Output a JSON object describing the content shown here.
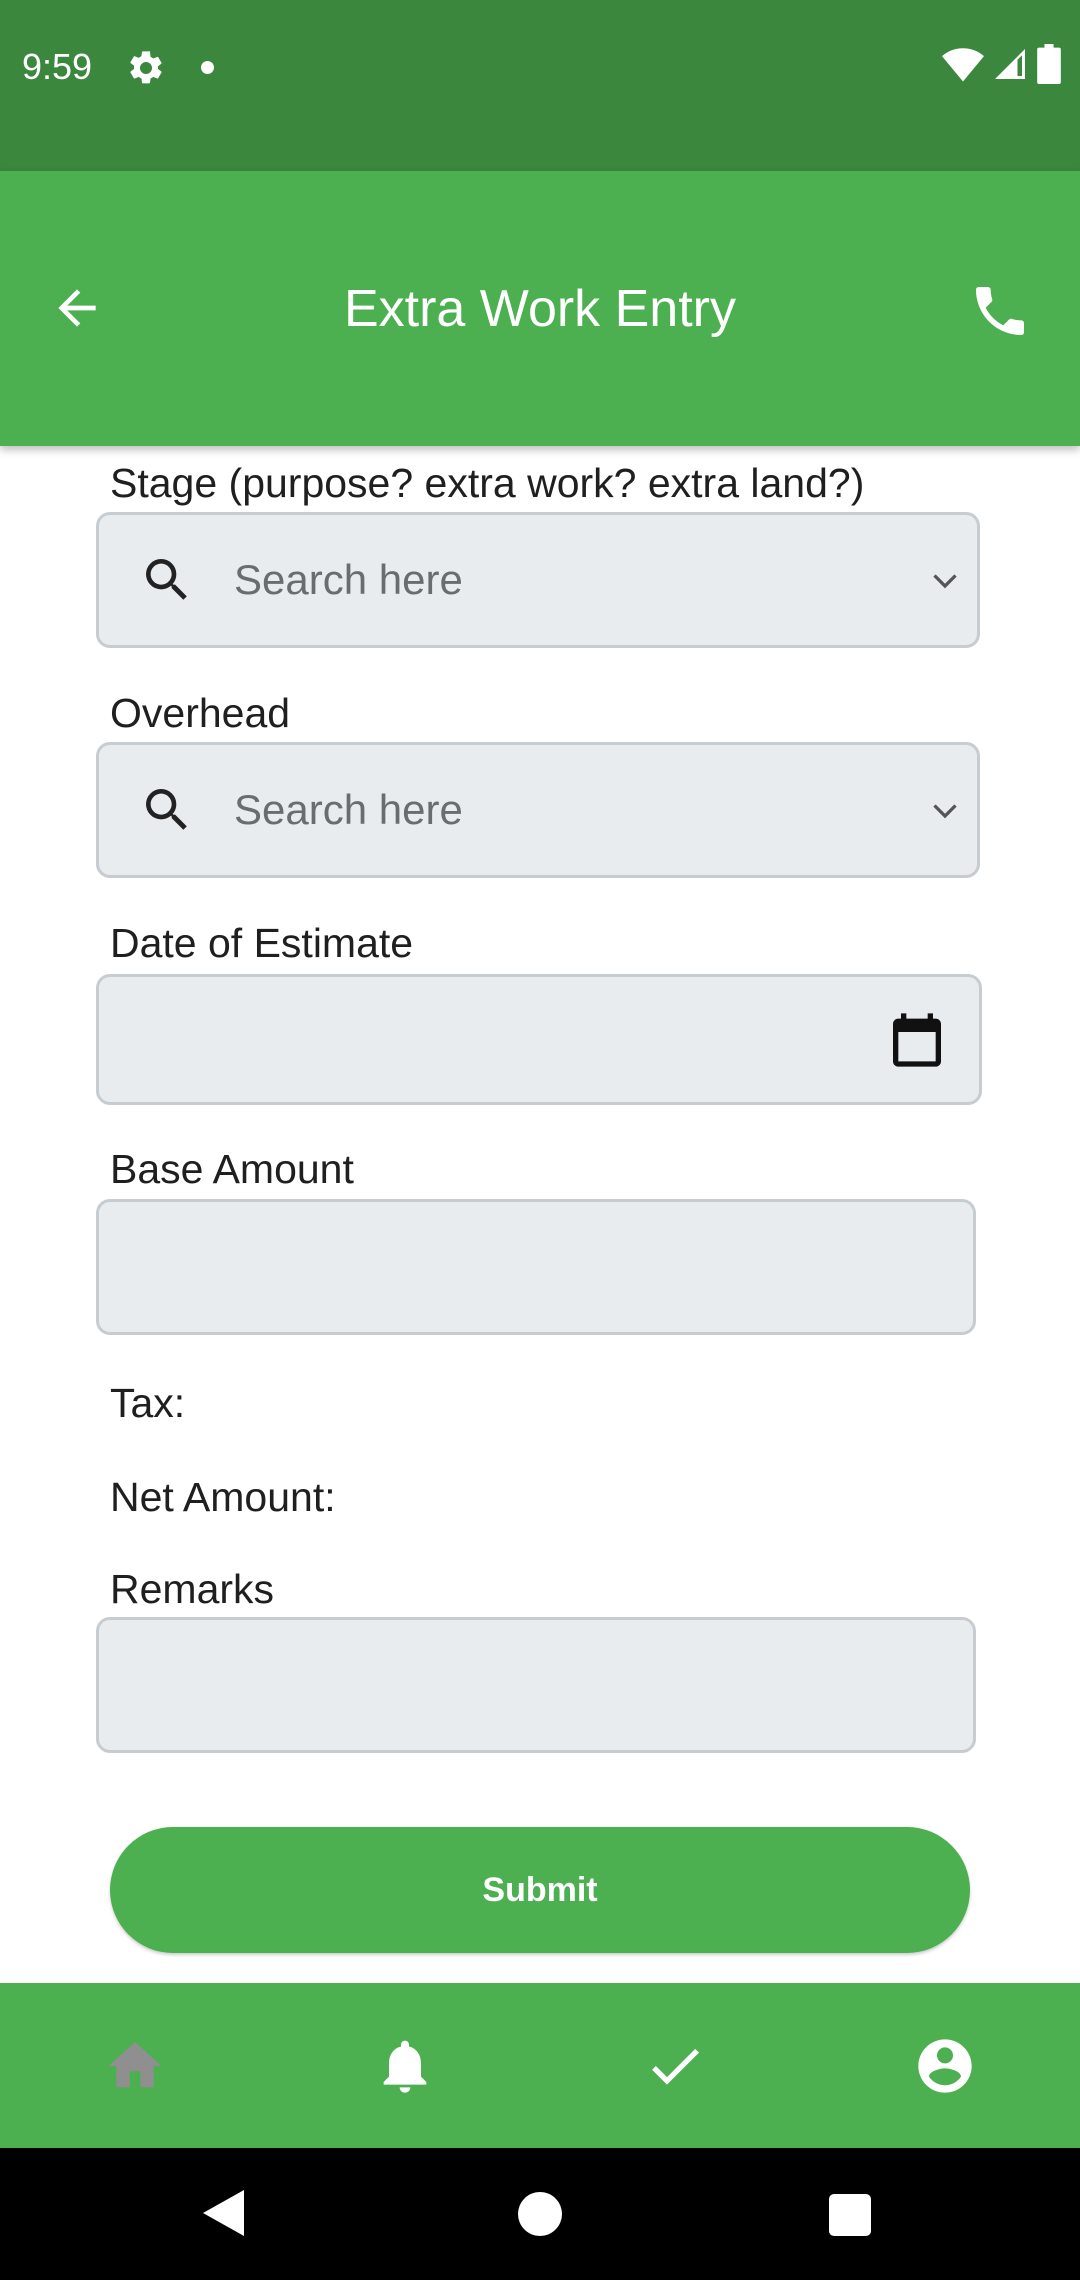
{
  "status_bar": {
    "time": "9:59",
    "icons": [
      "gear-icon",
      "notification-dot-icon",
      "wifi-icon",
      "signal-icon",
      "battery-icon"
    ]
  },
  "app_bar": {
    "title": "Extra Work Entry",
    "back_icon": "arrow-back-icon",
    "call_icon": "phone-icon",
    "color": "#4caf50"
  },
  "form": {
    "stage": {
      "label": "Stage (purpose? extra work? extra land?)",
      "placeholder": "Search here"
    },
    "overhead": {
      "label": "Overhead",
      "placeholder": "Search here"
    },
    "date_of_estimate": {
      "label": "Date of Estimate",
      "value": ""
    },
    "base_amount": {
      "label": "Base Amount",
      "value": ""
    },
    "tax": {
      "label": "Tax:"
    },
    "net_amount": {
      "label": "Net Amount:"
    },
    "remarks": {
      "label": "Remarks",
      "value": ""
    },
    "submit_label": "Submit"
  },
  "bottom_nav": {
    "items": [
      {
        "icon": "home-icon",
        "active": false
      },
      {
        "icon": "bell-icon",
        "active": false
      },
      {
        "icon": "check-icon",
        "active": false
      },
      {
        "icon": "account-circle-icon",
        "active": false
      }
    ]
  },
  "system_nav": {
    "icons": [
      "system-back-icon",
      "system-home-icon",
      "system-recents-icon"
    ]
  },
  "colors": {
    "primary": "#4caf50",
    "status_bar": "#3b873e",
    "field_bg": "#e9ecef",
    "field_border": "#c7ccd1"
  }
}
